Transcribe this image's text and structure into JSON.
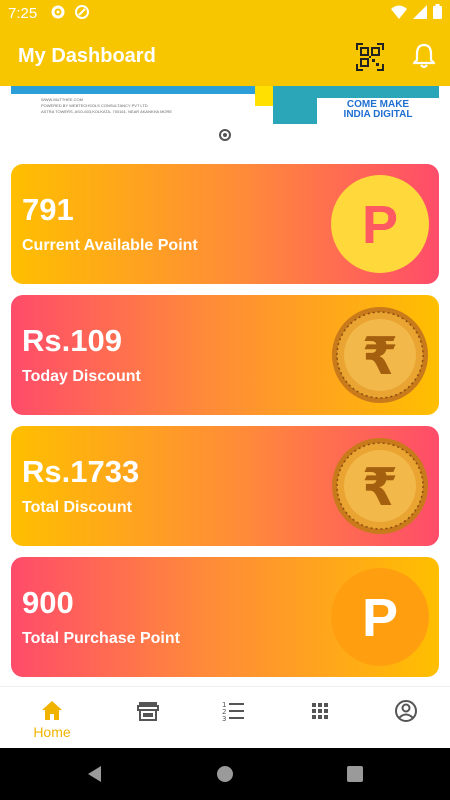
{
  "status_bar": {
    "time": "7:25",
    "icons": [
      "settings-icon",
      "sync-icon",
      "wifi-icon",
      "signal-icon",
      "battery-icon"
    ]
  },
  "app_bar": {
    "title": "My Dashboard",
    "icons": [
      "qr-code-icon",
      "bell-icon"
    ]
  },
  "banner": {
    "fine_print_1": "WWW.MUTTHEE.COM",
    "fine_print_2": "POWERED BY WEBTECHSOLS CONSULTANCY PVT LTD",
    "fine_print_3": "ASTRA TOWERS, ASO-603,KOLKATA- 700161, NEAR AKANKHA MORE",
    "cta_line_1": "COME MAKE",
    "cta_line_2": "INDIA DIGITAL",
    "pager_dots": 1
  },
  "cards": [
    {
      "value": "791",
      "label": "Current Available Point",
      "icon": "points-p-icon"
    },
    {
      "value": "Rs.109",
      "label": "Today Discount",
      "icon": "rupee-coin-icon"
    },
    {
      "value": "Rs.1733",
      "label": "Total Discount",
      "icon": "rupee-coin-icon"
    },
    {
      "value": "900",
      "label": "Total Purchase Point",
      "icon": "points-p-icon"
    }
  ],
  "bottom_nav": {
    "items": [
      {
        "label": "Home",
        "icon": "home-icon",
        "active": true
      },
      {
        "label": "",
        "icon": "store-icon",
        "active": false
      },
      {
        "label": "",
        "icon": "numbered-list-icon",
        "active": false
      },
      {
        "label": "",
        "icon": "apps-grid-icon",
        "active": false
      },
      {
        "label": "",
        "icon": "account-icon",
        "active": false
      }
    ]
  },
  "system_nav": [
    "back-icon",
    "home-circle-icon",
    "recents-icon"
  ],
  "colors": {
    "primary": "#f7c600",
    "accent_pink": "#ff4c6a",
    "accent_orange": "#ff8a3a",
    "nav_active": "#f0b400"
  }
}
